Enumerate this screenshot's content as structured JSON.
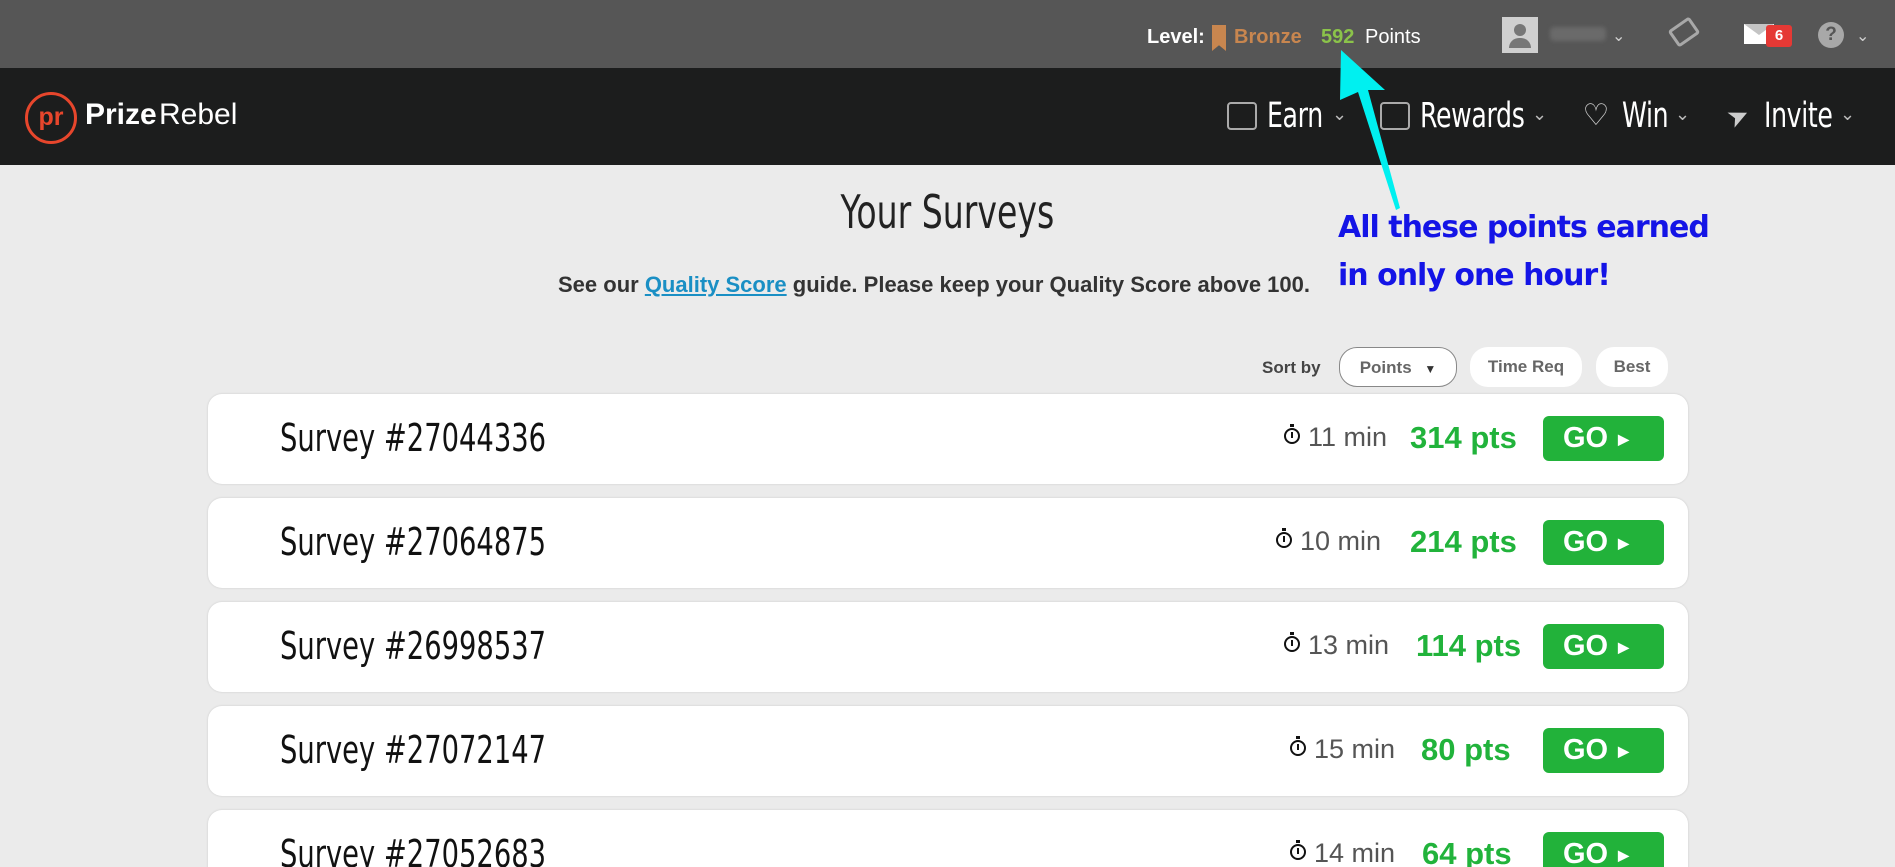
{
  "topbar": {
    "level_label": "Level:",
    "level_name": "Bronze",
    "points_value": "592",
    "points_label": "Points",
    "mail_count": "6",
    "help_glyph": "?",
    "icons": [
      "bookmark-icon",
      "avatar",
      "ticket-icon",
      "mail-icon",
      "help-icon"
    ]
  },
  "nav": {
    "logo_mark": "pr",
    "logo_bold": "Prize",
    "logo_light": "Rebel",
    "items": [
      {
        "label": "Earn",
        "icon": "wallet-icon"
      },
      {
        "label": "Rewards",
        "icon": "shopping-bag-icon"
      },
      {
        "label": "Win",
        "icon": "heart-icon"
      },
      {
        "label": "Invite",
        "icon": "paper-plane-icon"
      }
    ]
  },
  "main": {
    "title": "Your Surveys",
    "subtitle_pre": "See our ",
    "subtitle_link": "Quality Score",
    "subtitle_post": " guide. Please keep your Quality Score above 100."
  },
  "annotation": {
    "line1": "All these points earned",
    "line2": "in only one hour!",
    "color": "#1414e6",
    "arrow_color": "#00f0f0"
  },
  "sort": {
    "label": "Sort by",
    "options": [
      "Points",
      "Time Req",
      "Best"
    ],
    "active": "Points"
  },
  "surveys": [
    {
      "title": "Survey #27044336",
      "time": "11 min",
      "points": "314 pts",
      "go": "GO"
    },
    {
      "title": "Survey #27064875",
      "time": "10 min",
      "points": "214 pts",
      "go": "GO"
    },
    {
      "title": "Survey #26998537",
      "time": "13 min",
      "points": "114 pts",
      "go": "GO"
    },
    {
      "title": "Survey #27072147",
      "time": "15 min",
      "points": "80 pts",
      "go": "GO"
    },
    {
      "title": "Survey #27052683",
      "time": "14 min",
      "points": "64 pts",
      "go": "GO"
    }
  ],
  "colors": {
    "topbar": "#565656",
    "navbar": "#1c1d1d",
    "accent_green": "#21b33b",
    "bronze": "#c8864f",
    "logo_red": "#e7462c",
    "link_blue": "#1a8fc4"
  }
}
